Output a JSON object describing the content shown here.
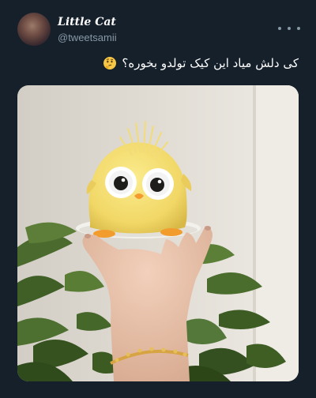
{
  "tweet": {
    "display_name": "Little Cat",
    "handle": "@tweetsamii",
    "text": "کی دلش میاد این کیک تولدو بخوره؟",
    "emoji_icon": "thinking-face-emoji"
  },
  "menu": {
    "icon": "more-dots-icon"
  },
  "colors": {
    "background": "#15202b",
    "secondary_text": "#8899a6"
  }
}
